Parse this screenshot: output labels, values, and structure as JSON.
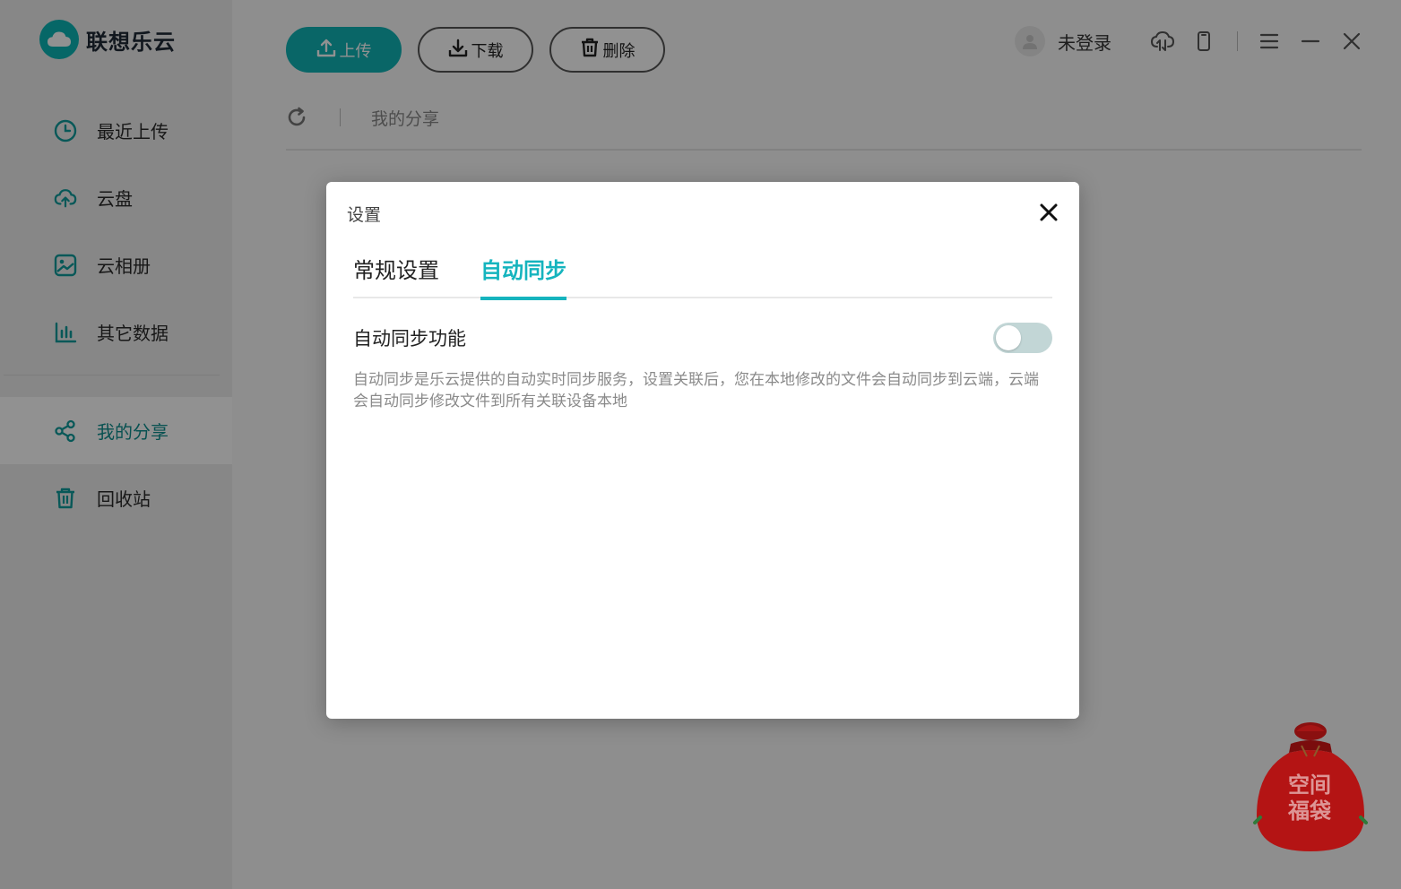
{
  "app": {
    "name": "联想乐云",
    "brand_color": "#11b3b6"
  },
  "sidebar": {
    "items": [
      {
        "label": "最近上传",
        "icon": "clock-icon"
      },
      {
        "label": "云盘",
        "icon": "cloud-upload-icon"
      },
      {
        "label": "云相册",
        "icon": "photo-icon"
      },
      {
        "label": "其它数据",
        "icon": "bar-chart-icon"
      },
      {
        "label": "我的分享",
        "icon": "share-icon",
        "active": true
      },
      {
        "label": "回收站",
        "icon": "trash-icon"
      }
    ]
  },
  "toolbar": {
    "upload": "上传",
    "download": "下载",
    "delete": "删除"
  },
  "user": {
    "status": "未登录"
  },
  "breadcrumb": {
    "current": "我的分享"
  },
  "dialog": {
    "title": "设置",
    "tabs": [
      {
        "label": "常规设置",
        "active": false
      },
      {
        "label": "自动同步",
        "active": true
      }
    ],
    "setting": {
      "label": "自动同步功能",
      "enabled": false,
      "description": "自动同步是乐云提供的自动实时同步服务，设置关联后，您在本地修改的文件会自动同步到云端，云端会自动同步修改文件到所有关联设备本地"
    }
  },
  "promo": {
    "line1": "空间",
    "line2": "福袋"
  }
}
